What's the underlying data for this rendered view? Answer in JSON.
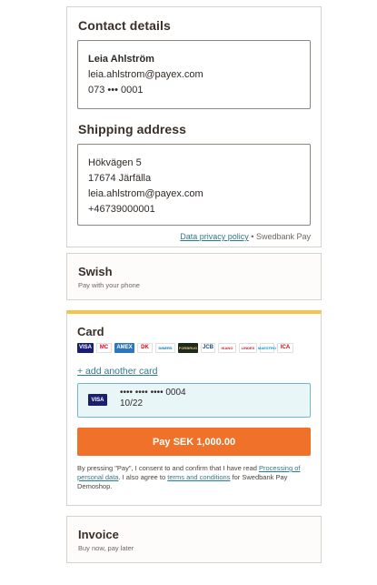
{
  "contact": {
    "title": "Contact details",
    "name": "Leia Ahlström",
    "email": "leia.ahlstrom@payex.com",
    "phone": "073 ••• 0001"
  },
  "shipping": {
    "title": "Shipping address",
    "street": "Hökvägen 5",
    "city": "17674 Järfälla",
    "email": "leia.ahlstrom@payex.com",
    "phone": "+46739000001"
  },
  "footer": {
    "privacy_link": "Data privacy policy",
    "separator": " • ",
    "brand": "Swedbank Pay"
  },
  "swish": {
    "name": "Swish",
    "sub": "Pay with your phone"
  },
  "card": {
    "name": "Card",
    "logos": [
      {
        "label": "VISA",
        "bg": "#1a1f71",
        "fg": "#ffffff"
      },
      {
        "label": "MC",
        "bg": "#ffffff",
        "fg": "#eb001b"
      },
      {
        "label": "AMEX",
        "bg": "#2e77bc",
        "fg": "#ffffff"
      },
      {
        "label": "DK",
        "bg": "#ffffff",
        "fg": "#e2001a"
      },
      {
        "label": "DINERS",
        "bg": "#ffffff",
        "fg": "#0079be"
      },
      {
        "label": "FORBRUG",
        "bg": "#1f2a1b",
        "fg": "#d6c27a"
      },
      {
        "label": "JCB",
        "bg": "#ffffff",
        "fg": "#0e4c96"
      },
      {
        "label": "IKANO",
        "bg": "#ffffff",
        "fg": "#d11f26"
      },
      {
        "label": "LINDEX",
        "bg": "#ffffff",
        "fg": "#c01f3b"
      },
      {
        "label": "MAESTRO",
        "bg": "#ffffff",
        "fg": "#0099df"
      },
      {
        "label": "ICA",
        "bg": "#ffffff",
        "fg": "#e3000b"
      }
    ],
    "add_card": "+ add another card",
    "saved_brand": "VISA",
    "saved_number": "•••• •••• •••• 0004",
    "saved_expiry": "10/22",
    "pay_button": "Pay SEK 1,000.00",
    "terms_1": "By pressing \"Pay\", I consent to and confirm that I have read ",
    "terms_link_1": "Processing of personal data",
    "terms_2": ". I also agree to ",
    "terms_link_2": "terms and conditions",
    "terms_3": " for Swedbank Pay Demoshop."
  },
  "invoice": {
    "name": "Invoice",
    "sub": "Buy now, pay later"
  }
}
